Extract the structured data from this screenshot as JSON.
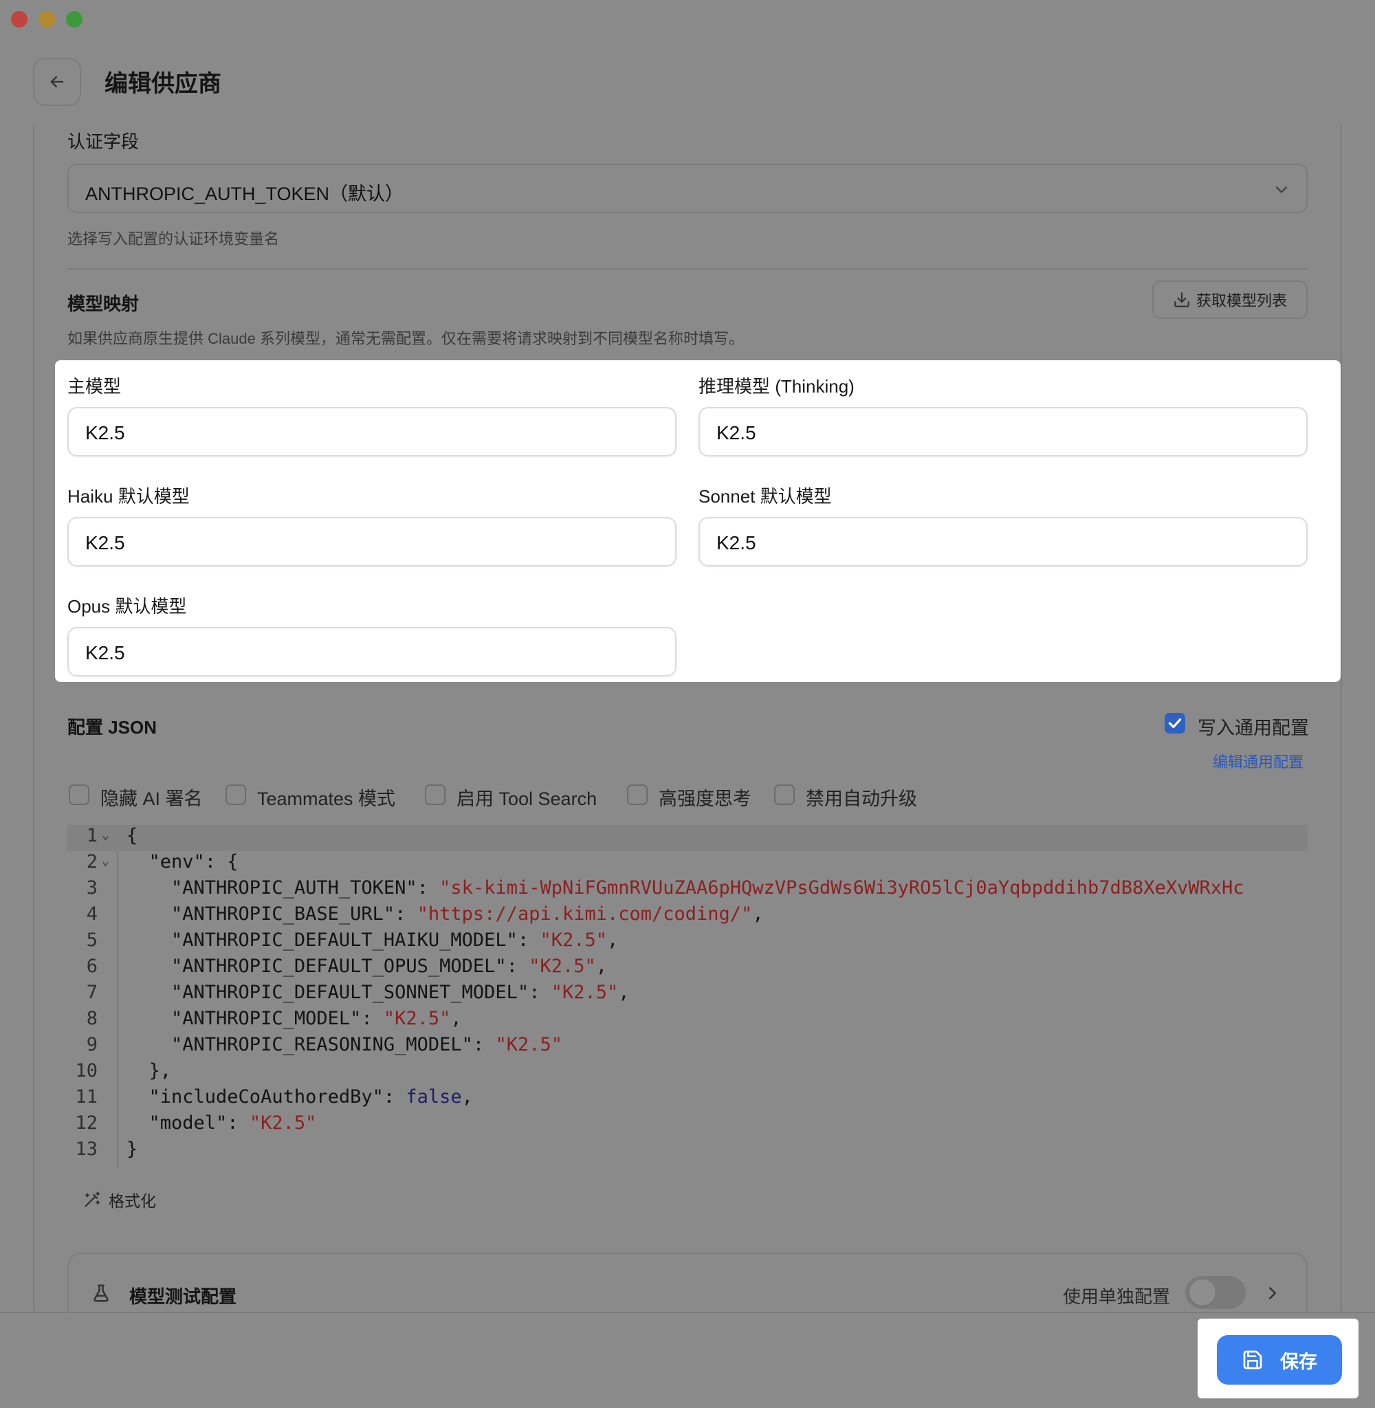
{
  "header": {
    "title": "编辑供应商"
  },
  "auth": {
    "label": "认证字段",
    "selected": "ANTHROPIC_AUTH_TOKEN（默认）",
    "hint": "选择写入配置的认证环境变量名"
  },
  "mapping": {
    "title": "模型映射",
    "fetch_label": "获取模型列表",
    "hint": "如果供应商原生提供 Claude 系列模型，通常无需配置。仅在需要将请求映射到不同模型名称时填写。",
    "fields": [
      {
        "label": "主模型",
        "value": "K2.5"
      },
      {
        "label": "推理模型 (Thinking)",
        "value": "K2.5"
      },
      {
        "label": "Haiku 默认模型",
        "value": "K2.5"
      },
      {
        "label": "Sonnet 默认模型",
        "value": "K2.5"
      },
      {
        "label": "Opus 默认模型",
        "value": "K2.5"
      }
    ]
  },
  "json_config": {
    "title": "配置 JSON",
    "write_common_label": "写入通用配置",
    "write_common_checked": true,
    "edit_common_label": "编辑通用配置",
    "options": [
      {
        "label": "隐藏 AI 署名",
        "checked": false
      },
      {
        "label": "Teammates 模式",
        "checked": false
      },
      {
        "label": "启用 Tool Search",
        "checked": false
      },
      {
        "label": "高强度思考",
        "checked": false
      },
      {
        "label": "禁用自动升级",
        "checked": false
      }
    ],
    "code_lines": [
      {
        "n": "1",
        "fold": true,
        "parts": [
          [
            "p",
            "{"
          ]
        ]
      },
      {
        "n": "2",
        "fold": true,
        "parts": [
          [
            "p",
            "  \"env\": {"
          ]
        ]
      },
      {
        "n": "3",
        "fold": false,
        "parts": [
          [
            "p",
            "    \"ANTHROPIC_AUTH_TOKEN\": "
          ],
          [
            "s",
            "\"sk-kimi-WpNiFGmnRVUuZAA6pHQwzVPsGdWs6Wi3yRO5lCj0aYqbpddihb7dB8XeXvWRxHc"
          ]
        ]
      },
      {
        "n": "4",
        "fold": false,
        "parts": [
          [
            "p",
            "    \"ANTHROPIC_BASE_URL\": "
          ],
          [
            "s",
            "\"https://api.kimi.com/coding/\""
          ],
          [
            "p",
            ","
          ]
        ]
      },
      {
        "n": "5",
        "fold": false,
        "parts": [
          [
            "p",
            "    \"ANTHROPIC_DEFAULT_HAIKU_MODEL\": "
          ],
          [
            "s",
            "\"K2.5\""
          ],
          [
            "p",
            ","
          ]
        ]
      },
      {
        "n": "6",
        "fold": false,
        "parts": [
          [
            "p",
            "    \"ANTHROPIC_DEFAULT_OPUS_MODEL\": "
          ],
          [
            "s",
            "\"K2.5\""
          ],
          [
            "p",
            ","
          ]
        ]
      },
      {
        "n": "7",
        "fold": false,
        "parts": [
          [
            "p",
            "    \"ANTHROPIC_DEFAULT_SONNET_MODEL\": "
          ],
          [
            "s",
            "\"K2.5\""
          ],
          [
            "p",
            ","
          ]
        ]
      },
      {
        "n": "8",
        "fold": false,
        "parts": [
          [
            "p",
            "    \"ANTHROPIC_MODEL\": "
          ],
          [
            "s",
            "\"K2.5\""
          ],
          [
            "p",
            ","
          ]
        ]
      },
      {
        "n": "9",
        "fold": false,
        "parts": [
          [
            "p",
            "    \"ANTHROPIC_REASONING_MODEL\": "
          ],
          [
            "s",
            "\"K2.5\""
          ]
        ]
      },
      {
        "n": "10",
        "fold": false,
        "parts": [
          [
            "p",
            "  },"
          ]
        ]
      },
      {
        "n": "11",
        "fold": false,
        "parts": [
          [
            "p",
            "  \"includeCoAuthoredBy\": "
          ],
          [
            "b",
            "false"
          ],
          [
            "p",
            ","
          ]
        ]
      },
      {
        "n": "12",
        "fold": false,
        "parts": [
          [
            "p",
            "  \"model\": "
          ],
          [
            "s",
            "\"K2.5\""
          ]
        ]
      },
      {
        "n": "13",
        "fold": false,
        "parts": [
          [
            "p",
            "}"
          ]
        ]
      }
    ],
    "format_label": "格式化"
  },
  "test_config": {
    "title": "模型测试配置",
    "toggle_label": "使用单独配置",
    "toggle_on": false
  },
  "footer": {
    "save_label": "保存"
  },
  "colors": {
    "accent": "#3b82f0",
    "checkbox_checked": "#2e61c4",
    "link": "#2c59b8",
    "json_string": "#8c1f1f",
    "json_bool": "#1d1d6e"
  }
}
